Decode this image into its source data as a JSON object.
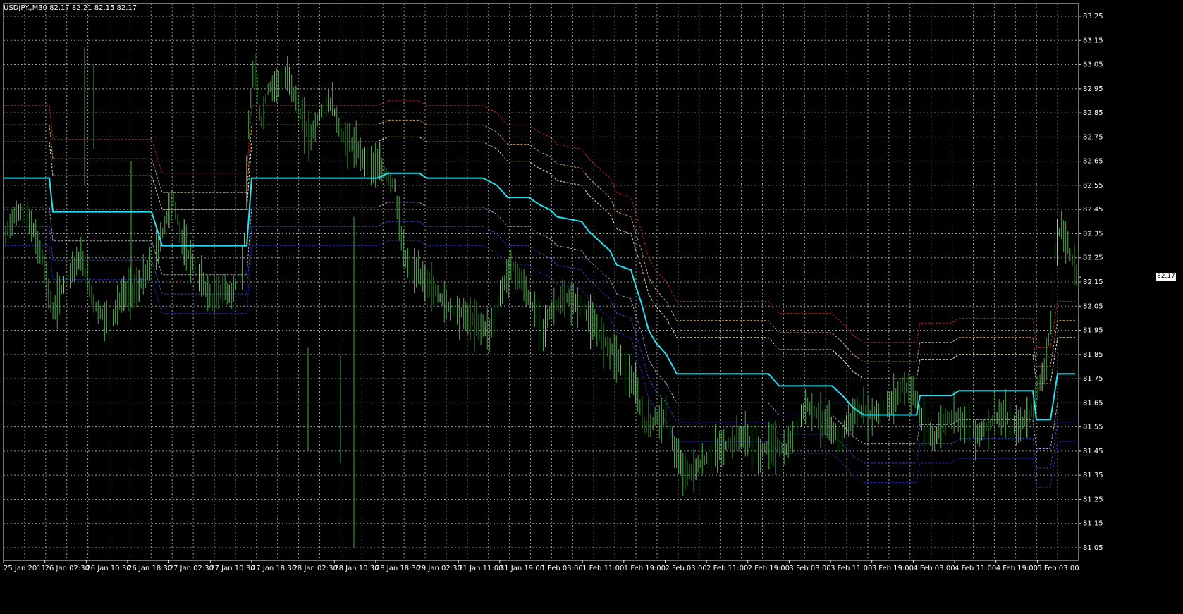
{
  "chart_header": {
    "symbol": "USDJPY.,M30",
    "ohlc": "82.17 82.21 82.15 82.17"
  },
  "colors": {
    "background": "#000000",
    "grid": "#9c9c9c",
    "axis": "#e8e8e8",
    "price_bars": "#3fae3f",
    "price_bars_light": "#8fd07a",
    "mid_line": "#28e0f0",
    "upper_outer": "#b42222",
    "upper_mid": "#d9a86a",
    "upper_inner": "#f0e4b0",
    "lower_inner": "#a9a9d6",
    "lower_mid": "#3a46c8",
    "lower_outer": "#1f2ba8",
    "current_price_tag_bg": "#ffffff",
    "current_price_tag_fg": "#000000"
  },
  "current_price": "82.17",
  "chart_data": {
    "type": "line",
    "title": "USDJPY.,M30",
    "ylim": [
      81.0,
      83.3
    ],
    "y_ticks": [
      "83.25",
      "83.15",
      "83.05",
      "82.95",
      "82.85",
      "82.75",
      "82.65",
      "82.55",
      "82.45",
      "82.35",
      "82.25",
      "82.15",
      "82.05",
      "81.95",
      "81.85",
      "81.75",
      "81.65",
      "81.55",
      "81.45",
      "81.35",
      "81.25",
      "81.15",
      "81.05"
    ],
    "x_labels": [
      "25 Jan 2011",
      "26 Jan 02:30",
      "26 Jan 10:30",
      "26 Jan 18:30",
      "27 Jan 02:30",
      "27 Jan 10:30",
      "27 Jan 18:30",
      "28 Jan 02:30",
      "28 Jan 10:30",
      "28 Jan 18:30",
      "29 Jan 02:30",
      "31 Jan 11:00",
      "31 Jan 19:00",
      "1 Feb 03:00",
      "1 Feb 11:00",
      "1 Feb 19:00",
      "2 Feb 03:00",
      "2 Feb 11:00",
      "2 Feb 19:00",
      "3 Feb 03:00",
      "3 Feb 11:00",
      "3 Feb 19:00",
      "4 Feb 03:00",
      "4 Feb 11:00",
      "4 Feb 19:00",
      "5 Feb 03:00"
    ],
    "bars_count": 500,
    "price_path": [
      [
        0,
        82.32
      ],
      [
        10,
        82.4
      ],
      [
        25,
        82.45
      ],
      [
        40,
        82.38
      ],
      [
        55,
        82.25
      ],
      [
        70,
        82.02
      ],
      [
        90,
        82.18
      ],
      [
        110,
        82.25
      ],
      [
        130,
        82.05
      ],
      [
        150,
        81.98
      ],
      [
        170,
        82.1
      ],
      [
        190,
        82.12
      ],
      [
        210,
        82.22
      ],
      [
        225,
        82.35
      ],
      [
        240,
        82.5
      ],
      [
        255,
        82.3
      ],
      [
        275,
        82.2
      ],
      [
        295,
        82.07
      ],
      [
        310,
        82.12
      ],
      [
        325,
        82.1
      ],
      [
        340,
        82.22
      ],
      [
        348,
        82.8
      ],
      [
        355,
        83.05
      ],
      [
        365,
        82.8
      ],
      [
        375,
        82.95
      ],
      [
        390,
        82.98
      ],
      [
        405,
        83.0
      ],
      [
        420,
        82.85
      ],
      [
        435,
        82.75
      ],
      [
        450,
        82.85
      ],
      [
        465,
        82.9
      ],
      [
        480,
        82.75
      ],
      [
        495,
        82.72
      ],
      [
        515,
        82.65
      ],
      [
        535,
        82.62
      ],
      [
        555,
        82.55
      ],
      [
        565,
        82.3
      ],
      [
        575,
        82.2
      ],
      [
        590,
        82.18
      ],
      [
        610,
        82.12
      ],
      [
        630,
        82.05
      ],
      [
        650,
        82.02
      ],
      [
        670,
        81.98
      ],
      [
        690,
        81.95
      ],
      [
        705,
        82.1
      ],
      [
        720,
        82.22
      ],
      [
        735,
        82.15
      ],
      [
        750,
        82.05
      ],
      [
        765,
        81.95
      ],
      [
        780,
        82.05
      ],
      [
        800,
        82.08
      ],
      [
        820,
        82.05
      ],
      [
        840,
        81.95
      ],
      [
        860,
        81.88
      ],
      [
        880,
        81.8
      ],
      [
        895,
        81.72
      ],
      [
        910,
        81.55
      ],
      [
        925,
        81.58
      ],
      [
        940,
        81.6
      ],
      [
        955,
        81.42
      ],
      [
        970,
        81.35
      ],
      [
        990,
        81.4
      ],
      [
        1010,
        81.45
      ],
      [
        1030,
        81.48
      ],
      [
        1050,
        81.52
      ],
      [
        1070,
        81.44
      ],
      [
        1090,
        81.48
      ],
      [
        1110,
        81.45
      ],
      [
        1125,
        81.55
      ],
      [
        1140,
        81.65
      ],
      [
        1155,
        81.6
      ],
      [
        1170,
        81.55
      ],
      [
        1185,
        81.5
      ],
      [
        1200,
        81.58
      ],
      [
        1215,
        81.62
      ],
      [
        1230,
        81.6
      ],
      [
        1245,
        81.62
      ],
      [
        1260,
        81.65
      ],
      [
        1275,
        81.72
      ],
      [
        1290,
        81.7
      ],
      [
        1305,
        81.55
      ],
      [
        1320,
        81.5
      ],
      [
        1335,
        81.58
      ],
      [
        1350,
        81.6
      ],
      [
        1365,
        81.57
      ],
      [
        1380,
        81.52
      ],
      [
        1395,
        81.55
      ],
      [
        1410,
        81.6
      ],
      [
        1425,
        81.58
      ],
      [
        1440,
        81.55
      ],
      [
        1455,
        81.6
      ],
      [
        1465,
        81.68
      ],
      [
        1475,
        81.78
      ],
      [
        1485,
        81.95
      ],
      [
        1492,
        82.3
      ],
      [
        1500,
        82.38
      ],
      [
        1510,
        82.3
      ],
      [
        1520,
        82.2
      ],
      [
        1525,
        82.17
      ]
    ],
    "channel_steps": [
      [
        0,
        82.58
      ],
      [
        65,
        82.58
      ],
      [
        70,
        82.44
      ],
      [
        210,
        82.44
      ],
      [
        225,
        82.3
      ],
      [
        345,
        82.3
      ],
      [
        352,
        82.58
      ],
      [
        530,
        82.58
      ],
      [
        545,
        82.6
      ],
      [
        590,
        82.6
      ],
      [
        600,
        82.58
      ],
      [
        680,
        82.58
      ],
      [
        700,
        82.55
      ],
      [
        715,
        82.5
      ],
      [
        745,
        82.5
      ],
      [
        760,
        82.47
      ],
      [
        775,
        82.45
      ],
      [
        785,
        82.42
      ],
      [
        820,
        82.4
      ],
      [
        830,
        82.36
      ],
      [
        845,
        82.32
      ],
      [
        860,
        82.28
      ],
      [
        870,
        82.22
      ],
      [
        890,
        82.2
      ],
      [
        895,
        82.15
      ],
      [
        905,
        82.06
      ],
      [
        915,
        81.95
      ],
      [
        925,
        81.9
      ],
      [
        940,
        81.85
      ],
      [
        955,
        81.77
      ],
      [
        1085,
        81.77
      ],
      [
        1100,
        81.72
      ],
      [
        1175,
        81.72
      ],
      [
        1190,
        81.68
      ],
      [
        1205,
        81.63
      ],
      [
        1220,
        81.6
      ],
      [
        1295,
        81.6
      ],
      [
        1300,
        81.68
      ],
      [
        1345,
        81.68
      ],
      [
        1355,
        81.7
      ],
      [
        1460,
        81.7
      ],
      [
        1465,
        81.58
      ],
      [
        1485,
        81.58
      ],
      [
        1495,
        81.77
      ],
      [
        1520,
        81.77
      ]
    ],
    "band_offsets": {
      "upper_outer": 0.3,
      "upper_mid": 0.22,
      "upper_inner": 0.15,
      "lower_inner": -0.12,
      "lower_mid": -0.2,
      "lower_outer": -0.28
    }
  }
}
